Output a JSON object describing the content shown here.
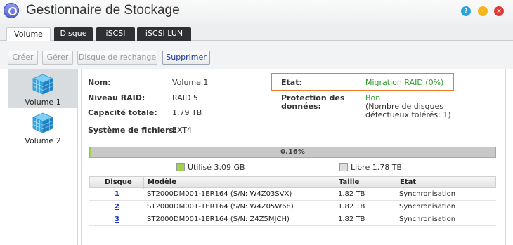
{
  "window": {
    "title": "Gestionnaire de Stockage",
    "help_icon": "?",
    "minimize_icon": "–",
    "close_icon": "×"
  },
  "tabs": [
    {
      "label": "Volume",
      "active": true
    },
    {
      "label": "Disque",
      "active": false
    },
    {
      "label": "iSCSI",
      "active": false
    },
    {
      "label": "iSCSI LUN",
      "active": false
    }
  ],
  "toolbar": {
    "create": "Créer",
    "manage": "Gérer",
    "spare": "Disque de rechange",
    "delete": "Supprimer"
  },
  "sidebar": {
    "items": [
      {
        "label": "Volume 1",
        "icon": "cube-stack-icon",
        "selected": true
      },
      {
        "label": "Volume 2",
        "icon": "cube-stack-icon",
        "selected": false
      }
    ]
  },
  "details": {
    "name_label": "Nom:",
    "name_value": "Volume 1",
    "raid_label": "Niveau RAID:",
    "raid_value": "RAID 5",
    "capacity_label": "Capacité totale:",
    "capacity_value": "1.79 TB",
    "fs_label": "Système de fichiers:",
    "fs_value": "EXT4",
    "state_label": "Etat:",
    "state_value": "Migration RAID (0%)",
    "protection_label_1": "Protection des",
    "protection_label_2": "données:",
    "protection_value": "Bon",
    "protection_note_1": "(Nombre de disques",
    "protection_note_2": "défectueux tolérés: 1)"
  },
  "usage": {
    "percent_text": "0.16%",
    "percent_value": 0.16,
    "used": "Utilisé 3.09 GB",
    "free": "Libre 1.78 TB",
    "used_color": "#9fd34f",
    "free_color": "#dedede"
  },
  "disks": {
    "headers": [
      "Disque",
      "Modèle",
      "Taille",
      "Etat"
    ],
    "rows": [
      {
        "disk": "1",
        "model": "ST2000DM001-1ER164 (S/N: W4Z03SVX)",
        "size": "1.82 TB",
        "state": "Synchronisation"
      },
      {
        "disk": "2",
        "model": "ST2000DM001-1ER164 (S/N: W4Z05W68)",
        "size": "1.82 TB",
        "state": "Synchronisation"
      },
      {
        "disk": "3",
        "model": "ST2000DM001-1ER164 (S/N: Z4Z5MJCH)",
        "size": "1.82 TB",
        "state": "Synchronisation"
      }
    ]
  },
  "colors": {
    "accent_state": "#2f9a2f",
    "highlight_box": "#f07a2a",
    "link": "#1a33c8"
  }
}
